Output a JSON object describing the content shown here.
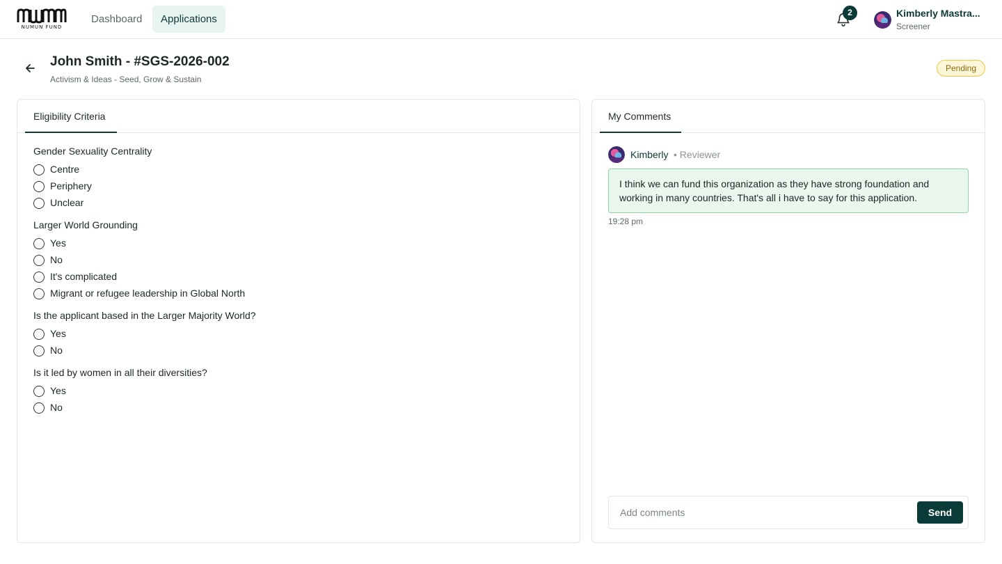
{
  "header": {
    "logo_text": "NUMUN FUND",
    "nav": [
      {
        "label": "Dashboard",
        "active": false
      },
      {
        "label": "Applications",
        "active": true
      }
    ],
    "notifications_count": "2",
    "user": {
      "name": "Kimberly Mastra...",
      "role": "Screener"
    }
  },
  "page": {
    "title": "John Smith - #SGS-2026-002",
    "subtitle": "Activism & Ideas - Seed, Grow & Sustain",
    "status": "Pending"
  },
  "eligibility": {
    "tab_label": "Eligibility Criteria",
    "questions": [
      {
        "title": "Gender Sexuality Centrality",
        "options": [
          "Centre",
          "Periphery",
          "Unclear"
        ]
      },
      {
        "title": "Larger World Grounding",
        "options": [
          "Yes",
          "No",
          "It's complicated",
          "Migrant or refugee leadership in Global North"
        ]
      },
      {
        "title": "Is the applicant based in the Larger Majority World?",
        "options": [
          "Yes",
          "No"
        ]
      },
      {
        "title": "Is it led by women in all their diversities?",
        "options": [
          "Yes",
          "No"
        ]
      }
    ]
  },
  "comments": {
    "tab_label": "My Comments",
    "items": [
      {
        "author": "Kimberly",
        "role": "• Reviewer",
        "text": "I think we can fund this organization as they have strong foundation and working in many countries. That's all i have to say for this application.",
        "time": "19:28 pm"
      }
    ],
    "input_placeholder": "Add comments",
    "send_label": "Send"
  },
  "colors": {
    "brand_dark": "#0b3b38",
    "nav_active_bg": "#e8f4f1",
    "pending_bg": "#fdf6d8",
    "pending_border": "#f0c542",
    "comment_bg": "#e9f7ee",
    "comment_border": "#8fd0a4"
  }
}
